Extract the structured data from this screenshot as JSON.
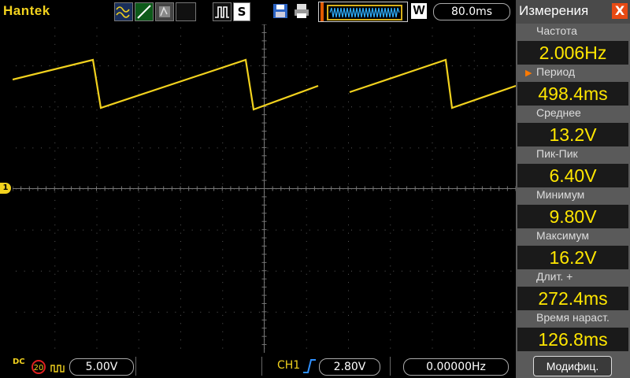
{
  "brand": "Hantek",
  "toolbar": {
    "icons": [
      "sine-wave-icon",
      "ramp-icon",
      "persist-icon",
      "run-stop-icon",
      "s-icon",
      "save-icon",
      "print-icon"
    ],
    "s_label": "S",
    "w_label": "W",
    "timebase": "80.0ms"
  },
  "bottom": {
    "coupling": "DC",
    "bw_limit": "20",
    "volts_div": "5.00V",
    "trigger_source": "CH1",
    "trigger_level": "2.80V",
    "frequency": "0.00000Hz"
  },
  "channel": {
    "marker": "1",
    "color": "#f2d21e"
  },
  "panel": {
    "title": "Измерения",
    "close_label": "X",
    "items": [
      {
        "label": "Частота",
        "value": "2.006Hz"
      },
      {
        "label": "Период",
        "value": "498.4ms",
        "selected": true
      },
      {
        "label": "Среднее",
        "value": "13.2V"
      },
      {
        "label": "Пик-Пик",
        "value": "6.40V"
      },
      {
        "label": "Минимум",
        "value": "9.80V"
      },
      {
        "label": "Максимум",
        "value": "16.2V"
      },
      {
        "label": "Длит. +",
        "value": "272.4ms"
      },
      {
        "label": "Время нараст.",
        "value": "126.8ms"
      }
    ],
    "modify_label": "Модифиц."
  },
  "colors": {
    "trace": "#f2d21e",
    "accent": "#e84a14",
    "panel": "#5a5a5a"
  }
}
